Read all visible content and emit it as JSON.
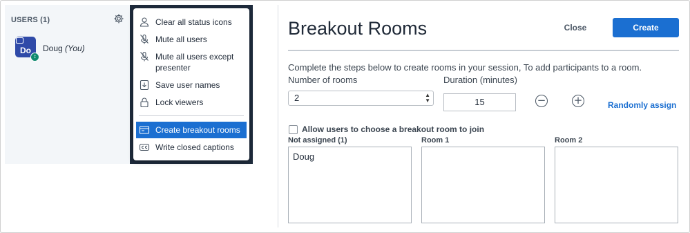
{
  "users_panel": {
    "title": "USERS (1)",
    "user": {
      "initials": "Do",
      "name": "Doug",
      "suffix": "(You)"
    }
  },
  "menu": {
    "items": [
      {
        "label": "Clear all status icons",
        "icon": "person-icon"
      },
      {
        "label": "Mute all users",
        "icon": "mic-off-icon"
      },
      {
        "label": "Mute all users except presenter",
        "icon": "mic-off-icon"
      },
      {
        "label": "Save user names",
        "icon": "download-icon"
      },
      {
        "label": "Lock viewers",
        "icon": "lock-icon"
      },
      {
        "label": "Create breakout rooms",
        "icon": "breakout-icon",
        "active": true
      },
      {
        "label": "Write closed captions",
        "icon": "cc-icon"
      }
    ]
  },
  "dialog": {
    "title": "Breakout Rooms",
    "close_label": "Close",
    "create_label": "Create",
    "instructions": "Complete the steps below to create rooms in your session, To add participants to a room.",
    "rooms_label": "Number of rooms",
    "rooms_value": "2",
    "duration_label": "Duration (minutes)",
    "duration_value": "15",
    "randomly_assign": "Randomly assign",
    "allow_choose": "Allow users to choose a breakout room to join",
    "columns": [
      {
        "label": "Not assigned (1)",
        "users": [
          "Doug"
        ]
      },
      {
        "label": "Room 1",
        "users": []
      },
      {
        "label": "Room 2",
        "users": []
      }
    ]
  },
  "colors": {
    "accent": "#1b6fd1",
    "sidebar_bg": "#f3f6f9",
    "dark_bg": "#1e2b3c",
    "avatar_bg": "#2f4aa8"
  }
}
